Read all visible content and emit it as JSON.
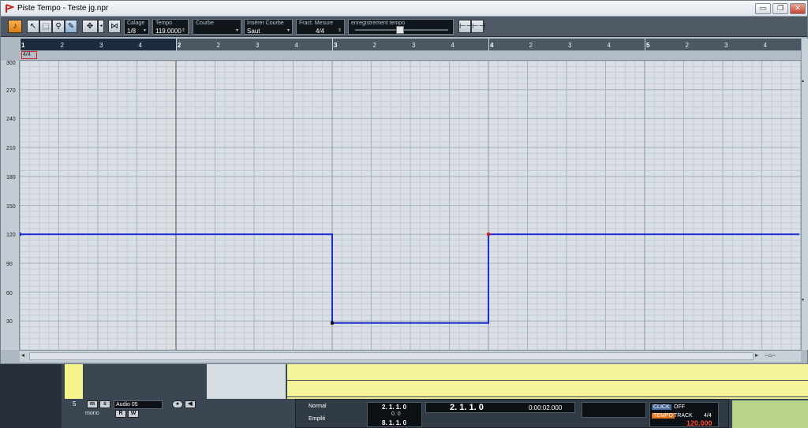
{
  "window": {
    "title": "Piste Tempo - Teste jg.npr",
    "controls": [
      "▭",
      "❐",
      "✕"
    ]
  },
  "toolbar": {
    "tools": [
      "select-tool",
      "range-tool",
      "zoom-tool",
      "draw-tool"
    ],
    "fields": [
      {
        "label": "Calage",
        "value": "1/8"
      },
      {
        "label": "Tempo",
        "value": "119.0000"
      },
      {
        "label": "Courbe",
        "value": ""
      },
      {
        "label": "Insérer Courbe",
        "value": "Saut"
      },
      {
        "label": "Fract. Mesure",
        "value": "4/4"
      },
      {
        "label": "enregistrement tempo",
        "value": ""
      }
    ]
  },
  "ruler": {
    "bars": [
      "1",
      "2",
      "3",
      "4",
      "5"
    ],
    "beats": [
      "2",
      "3",
      "4"
    ]
  },
  "signature": "4/4",
  "tempo_axis": {
    "labels": [
      "300",
      "270",
      "240",
      "210",
      "180",
      "150",
      "120",
      "90",
      "60",
      "30"
    ],
    "min": 0,
    "max": 300
  },
  "tempo_track": {
    "points": [
      {
        "bar": 1,
        "bpm": 120
      },
      {
        "bar": 3,
        "bpm": 120
      },
      {
        "bar": 3,
        "bpm": 28
      },
      {
        "bar": 4,
        "bpm": 28
      },
      {
        "bar": 4,
        "bpm": 120
      },
      {
        "bar": 5.99,
        "bpm": 120
      }
    ],
    "line_color": "#1a2fd0",
    "selected_point_color": "#e02020"
  },
  "background": {
    "track": {
      "number": "5",
      "mute": "m",
      "solo": "s",
      "name": "Audio 05",
      "mode": "mono",
      "read": "R",
      "write": "W"
    },
    "transport": {
      "mode1": "Normal",
      "mode2": "Empilé",
      "left_locator": "2. 1. 1.   0",
      "left_sub": "0.  0",
      "right_locator": "8. 1. 1.   0",
      "position": "2. 1. 1.   0",
      "time": "0:00:02.000",
      "click_label": "CLICK",
      "click_state": "OFF",
      "tempo_label": "TEMPO",
      "tempo_mode": "TRACK",
      "signature": "4/4",
      "tempo_value": "120.000"
    }
  }
}
